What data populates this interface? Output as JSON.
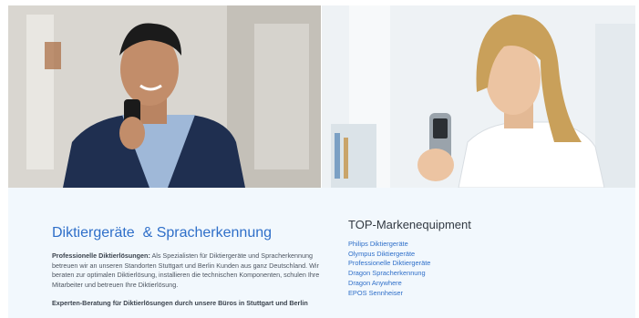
{
  "hero": {
    "left_image": "man-with-dictation-device-photo",
    "right_image": "woman-with-digital-recorder-photo"
  },
  "main": {
    "heading": "Diktiergeräte  & Spracherkennung",
    "intro_bold": "Professionelle Diktierlösungen:",
    "intro_text": " Als Spezialisten für Diktiergeräte und Spracherkennung betreuen wir an unseren Standorten Stuttgart und Berlin Kunden aus ganz Deutschland. Wir beraten zur optimalen Diktierlösung, installieren die technischen Komponenten, schulen Ihre Mitarbeiter und betreuen Ihre Diktierlösung.",
    "subline": "Experten-Beratung für Diktierlösungen durch unsere Büros in Stuttgart und Berlin"
  },
  "brands": {
    "heading": "TOP-Markenequipment",
    "items": [
      "Philips Diktiergeräte",
      "Olympus Diktiergeräte",
      "Professionelle Diktiergeräte",
      "Dragon Spracherkennung",
      "Dragon Anywhere",
      "EPOS Sennheiser"
    ]
  },
  "colors": {
    "accent": "#2f6fc9",
    "panel_bg": "#f2f8fd",
    "heading_dark": "#333a42"
  }
}
